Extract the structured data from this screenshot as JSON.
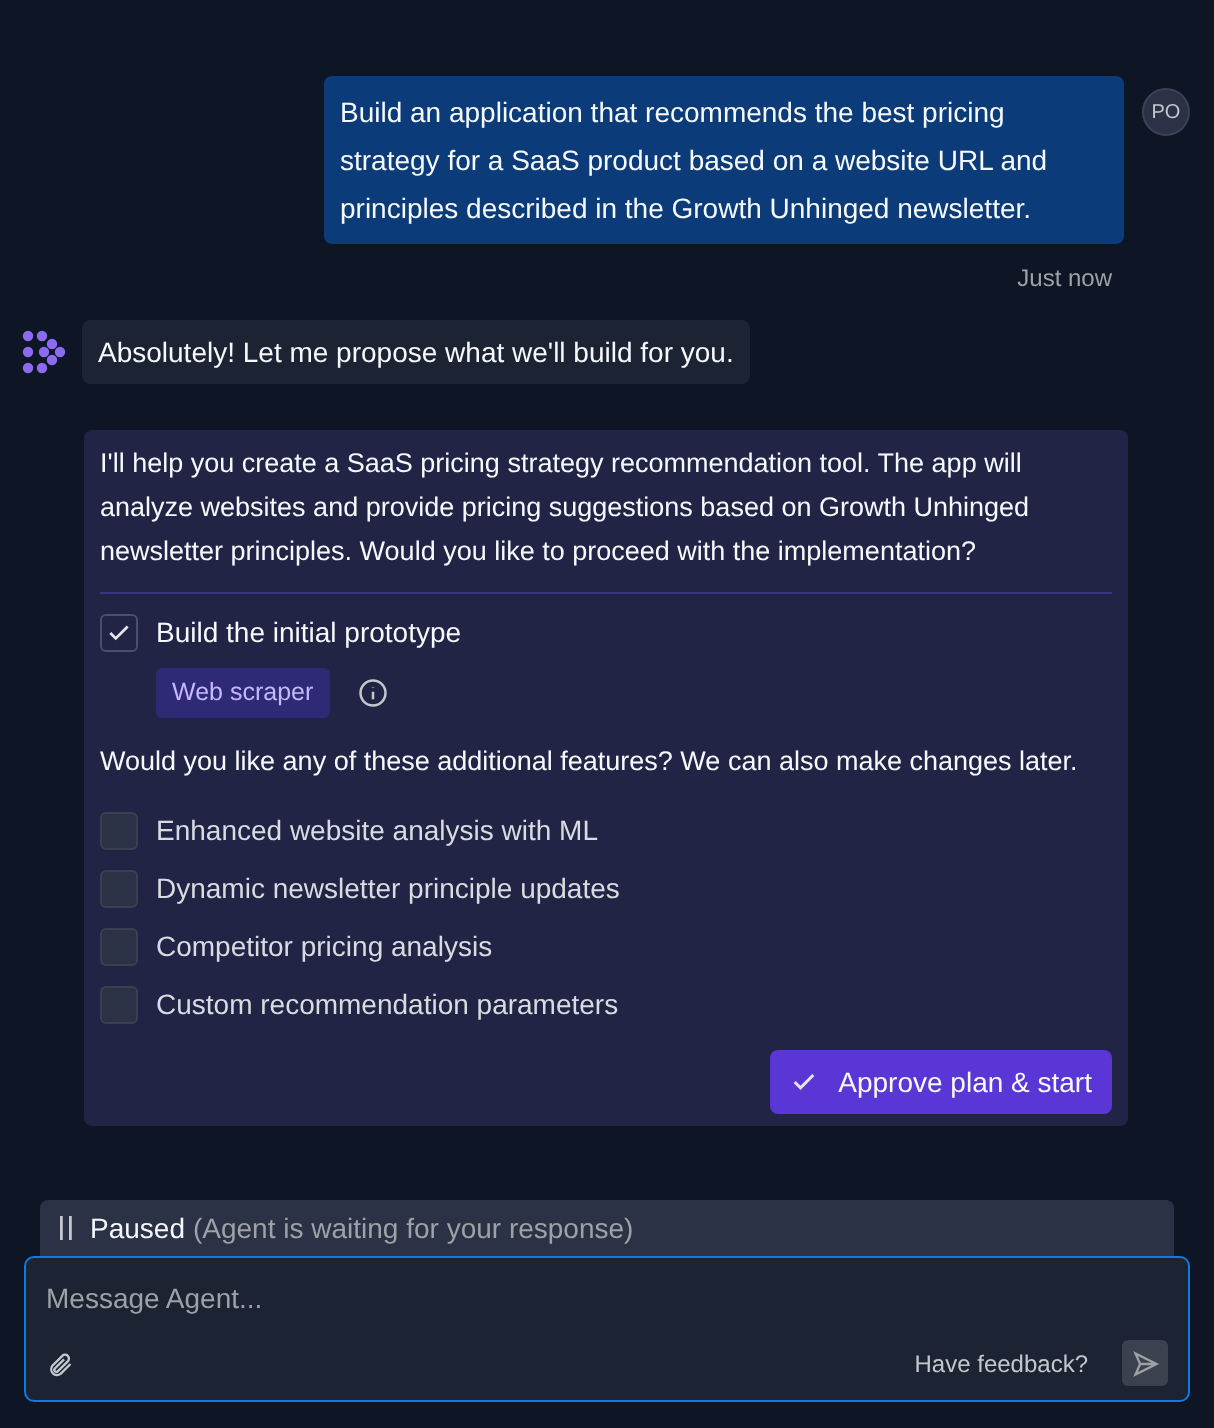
{
  "user_message": {
    "text": "Build an application that recommends the best pricing strategy for a SaaS product based on a website URL and principles described in the Growth Unhinged newsletter.",
    "avatar": "PO",
    "time": "Just now"
  },
  "agent_message": {
    "text": "Absolutely! Let me propose what we'll build for you."
  },
  "plan": {
    "summary": "I'll help you create a SaaS pricing strategy recommendation tool. The app will analyze websites and provide pricing suggestions based on Growth Unhinged newsletter principles. Would you like to proceed with the implementation?",
    "main_item": {
      "label": "Build the initial prototype",
      "checked": true,
      "tags": [
        "Web scraper"
      ]
    },
    "question": "Would you like any of these additional features? We can also make changes later.",
    "features": [
      {
        "label": "Enhanced website analysis with ML",
        "checked": false
      },
      {
        "label": "Dynamic newsletter principle updates",
        "checked": false
      },
      {
        "label": "Competitor pricing analysis",
        "checked": false
      },
      {
        "label": "Custom recommendation parameters",
        "checked": false
      }
    ],
    "approve_button": "Approve plan & start"
  },
  "status_bar": {
    "state": "Paused",
    "detail": "(Agent is waiting for your response)"
  },
  "composer": {
    "placeholder": "Message Agent...",
    "feedback_link": "Have feedback?"
  }
}
